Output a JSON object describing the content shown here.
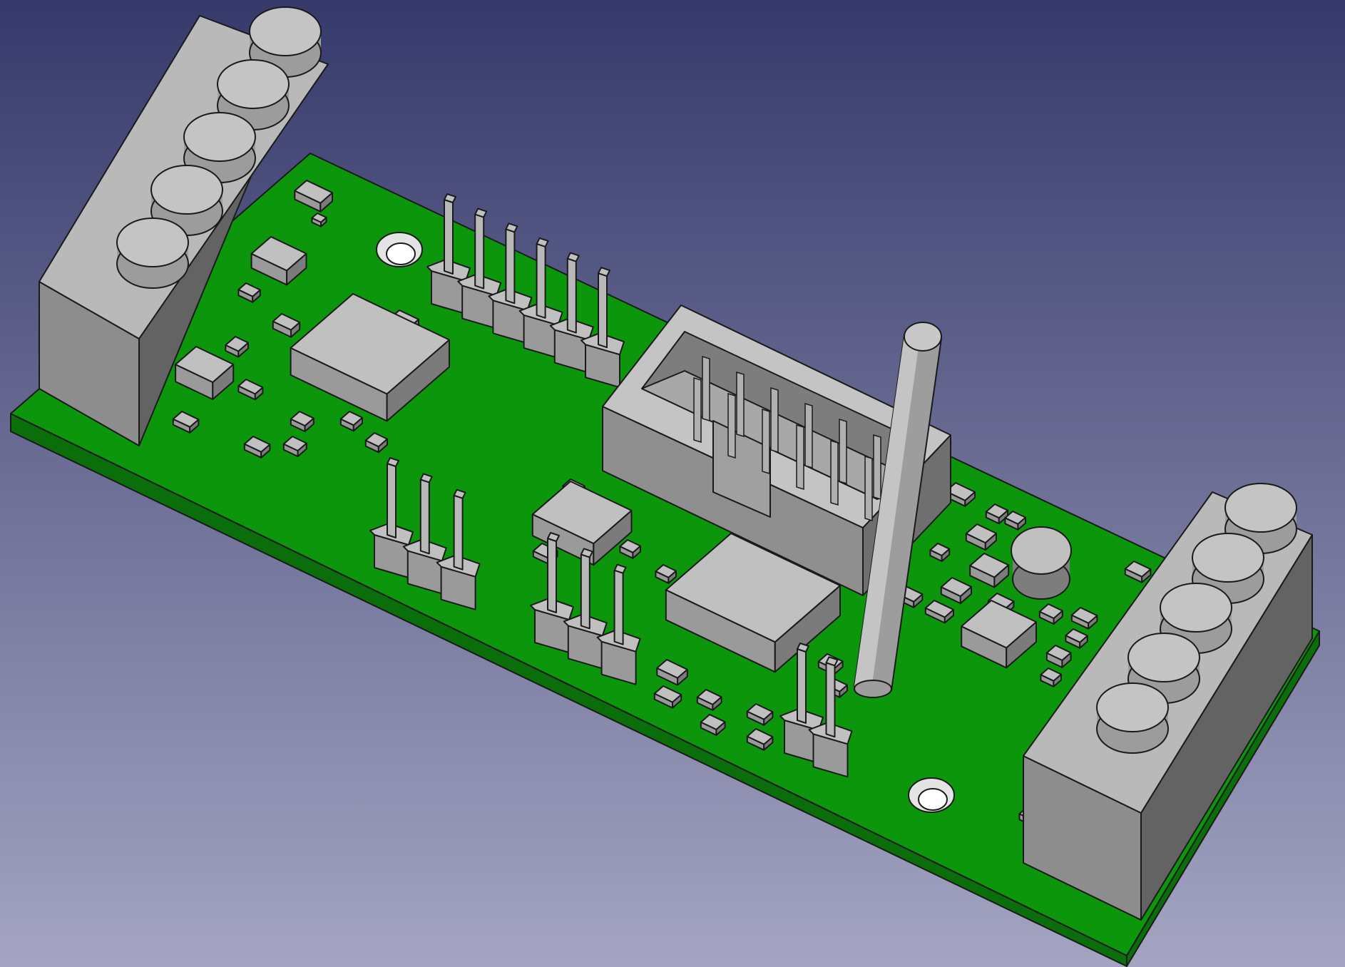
{
  "view": {
    "background_top": "#363a6b",
    "background_bottom": "#a4a4c2"
  },
  "model": {
    "pcb_color": "#0c960c",
    "pcb_edge_color": "#0a6e0a",
    "component_color": "#c0c0c0",
    "component_dark": "#7b7b7b",
    "component_mid": "#9a9a9a",
    "outline_color": "#1a1a1a"
  }
}
